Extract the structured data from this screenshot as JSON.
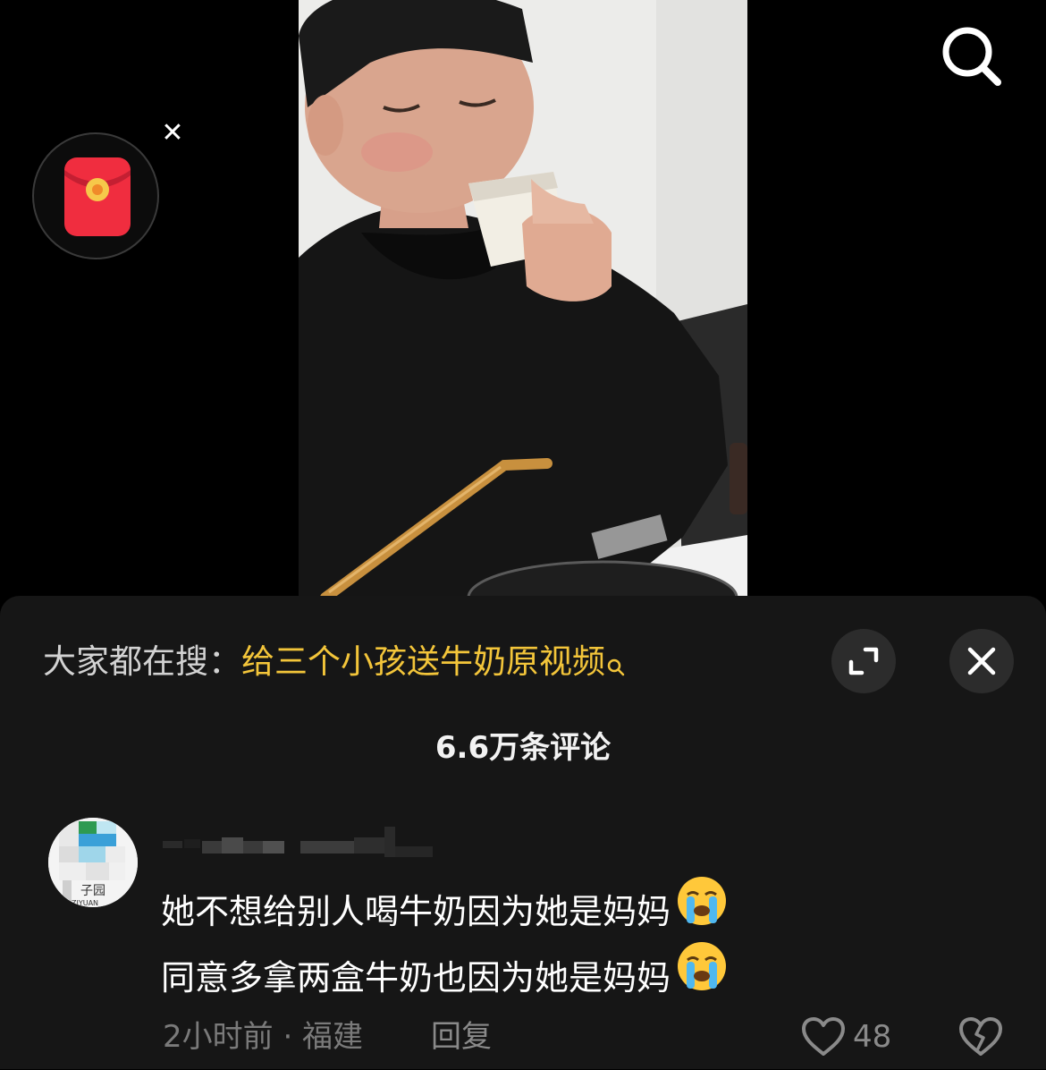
{
  "panel": {
    "hot_search_prefix": "大家都在搜：",
    "hot_search_query": "给三个小孩送牛奶原视频",
    "comment_count_label": "6.6万条评论"
  },
  "comment": {
    "line1": "她不想给别人喝牛奶因为她是妈妈",
    "line2": "同意多拿两盒牛奶也因为她是妈妈",
    "emoji": "loudly-crying-face",
    "meta": "2小时前 · 福建",
    "reply_label": "回复",
    "like_count": "48",
    "avatar_text": "子园",
    "avatar_subtext": "ZIYUAN"
  },
  "colors": {
    "accent_query": "#f3c53a",
    "panel_bg": "#161616",
    "muted_text": "#7a7a7a"
  }
}
